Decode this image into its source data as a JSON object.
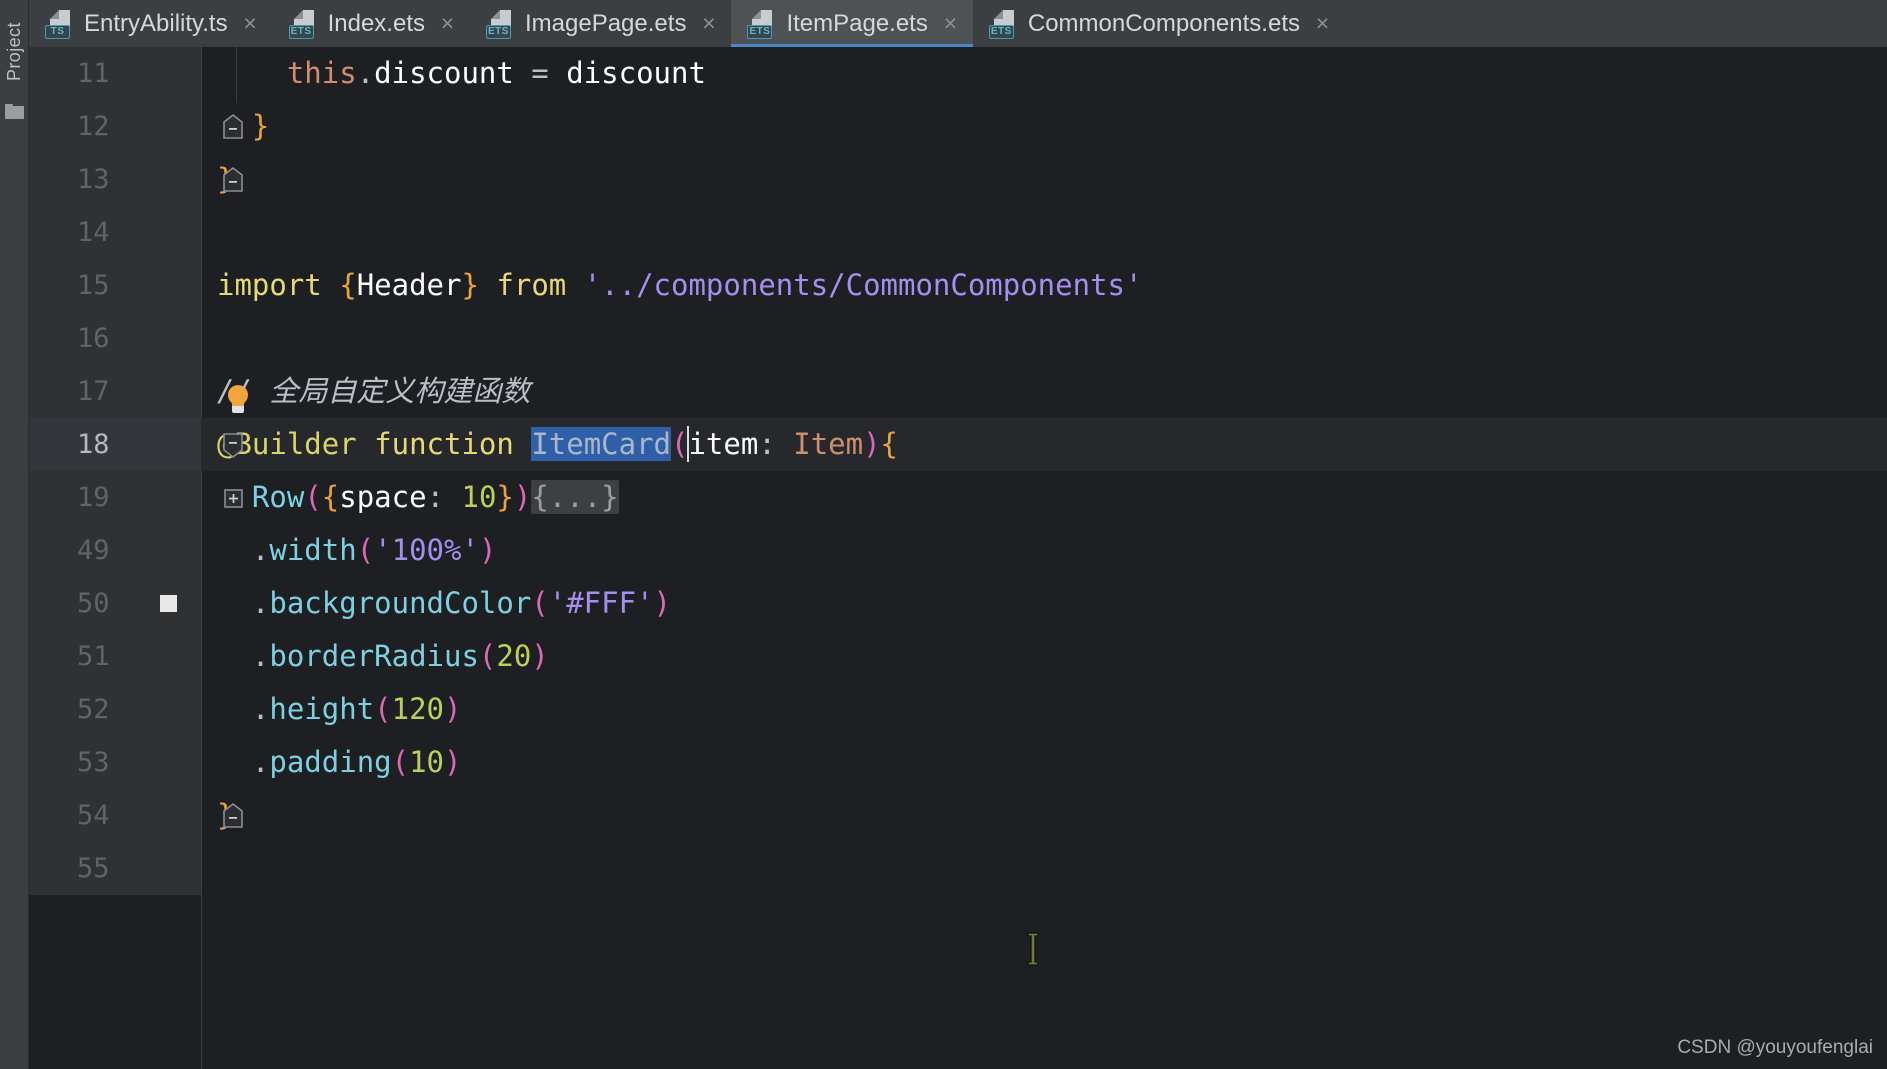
{
  "sidebar": {
    "tool_label": "Project",
    "folder_icon": "folder-icon"
  },
  "tabs": [
    {
      "label": "EntryAbility.ts",
      "badge": "TS",
      "active": false,
      "close": "×"
    },
    {
      "label": "Index.ets",
      "badge": "ETS",
      "active": false,
      "close": "×"
    },
    {
      "label": "ImagePage.ets",
      "badge": "ETS",
      "active": false,
      "close": "×"
    },
    {
      "label": "ItemPage.ets",
      "badge": "ETS",
      "active": true,
      "close": "×"
    },
    {
      "label": "CommonComponents.ets",
      "badge": "ETS",
      "active": false,
      "close": "×"
    }
  ],
  "editor": {
    "active_file": "ItemPage.ets",
    "current_line": 18,
    "selection_text": "ItemCard",
    "breakpoint_line": 50,
    "lines": [
      {
        "num": "11",
        "text": "        this.discount = discount"
      },
      {
        "num": "12",
        "text": "    }"
      },
      {
        "num": "13",
        "text": "}"
      },
      {
        "num": "14",
        "text": ""
      },
      {
        "num": "15",
        "text": "import {Header} from '../components/CommonComponents'"
      },
      {
        "num": "16",
        "text": ""
      },
      {
        "num": "17",
        "text": "// 全局自定义构建函数"
      },
      {
        "num": "18",
        "text": "@Builder function ItemCard(item: Item){"
      },
      {
        "num": "19",
        "text": "  Row({space: 10}){...}"
      },
      {
        "num": "49",
        "text": "  .width('100%')"
      },
      {
        "num": "50",
        "text": "  .backgroundColor('#FFF')"
      },
      {
        "num": "51",
        "text": "  .borderRadius(20)"
      },
      {
        "num": "52",
        "text": "  .height(120)"
      },
      {
        "num": "53",
        "text": "  .padding(10)"
      },
      {
        "num": "54",
        "text": "}"
      },
      {
        "num": "55",
        "text": ""
      }
    ],
    "comment_text": "// 全局自定义构建函数",
    "fold_placeholder": "{...}"
  },
  "watermark": "CSDN @youyoufenglai",
  "colors": {
    "tab_bar_bg": "#3c3f41",
    "active_tab_bg": "#4e5254",
    "active_tab_underline": "#4a88c7",
    "editor_bg": "#1e1f22",
    "gutter_bg": "#2f3133",
    "selection_blue": "#2f5fa8",
    "badge_teal": "#63b6c9",
    "bulb_orange": "#f0a63c"
  }
}
